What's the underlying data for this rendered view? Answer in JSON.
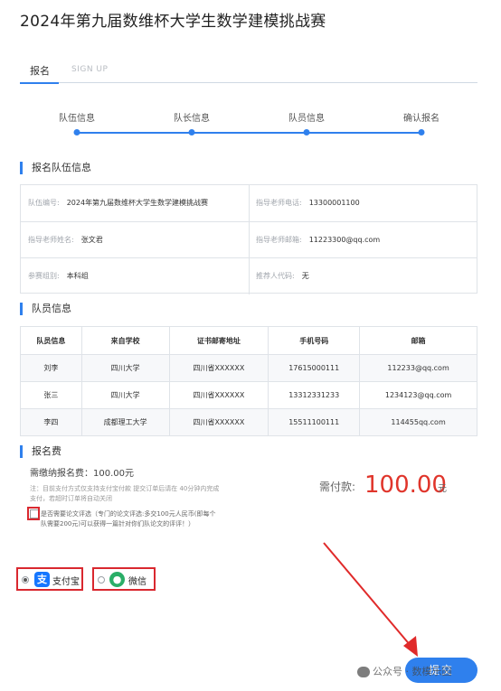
{
  "page": {
    "title": "2024年第九届数维杯大学生数学建模挑战赛"
  },
  "tabs": {
    "active": "报名",
    "inactive": "SIGN UP"
  },
  "steps": [
    "队伍信息",
    "队长信息",
    "队员信息",
    "确认报名"
  ],
  "team_section": {
    "heading": "报名队伍信息",
    "rows": [
      [
        {
          "key": "队伍编号:",
          "value": "2024年第九届数维杯大学生数学建模挑战赛"
        },
        {
          "key": "指导老师电话:",
          "value": "13300001100"
        }
      ],
      [
        {
          "key": "指导老师姓名:",
          "value": "张文君"
        },
        {
          "key": "指导老师邮箱:",
          "value": "11223300@qq.com"
        }
      ],
      [
        {
          "key": "参赛组别:",
          "value": "本科组"
        },
        {
          "key": "推荐人代码:",
          "value": "无"
        }
      ]
    ]
  },
  "members_section": {
    "heading": "队员信息",
    "columns": [
      "队员信息",
      "来自学校",
      "证书邮寄地址",
      "手机号码",
      "邮箱"
    ],
    "rows": [
      [
        "刘李",
        "四川大学",
        "四川省XXXXXX",
        "17615000111",
        "112233@qq.com"
      ],
      [
        "张三",
        "四川大学",
        "四川省XXXXXX",
        "13312331233",
        "1234123@qq.com"
      ],
      [
        "李四",
        "成都理工大学",
        "四川省XXXXXX",
        "15511100111",
        "114455qq.com"
      ]
    ]
  },
  "fee_section": {
    "heading": "报名费",
    "need_text": "需缴纳报名费：100.00元",
    "note": "注：目前支付方式仅支持支付宝付款 提交订单后请在 40分钟内完成支付，若超时订单将自动关闭",
    "pay_label": "需付款:",
    "pay_amount": "100.00",
    "pay_unit": "元",
    "review_text": "是否需要论文评选（专门的论文评选:多交100元人民币(即每个队需要200元)可以获得一篇针对你们队论文的评评！）"
  },
  "payment": {
    "alipay_label": "支付宝",
    "wechat_label": "微信",
    "selected": "alipay"
  },
  "submit_label": "提交",
  "watermark": "公众号 · 数模乐园",
  "colors": {
    "accent": "#2f80ed",
    "price": "#e0352b",
    "highlight": "#d9282f"
  }
}
